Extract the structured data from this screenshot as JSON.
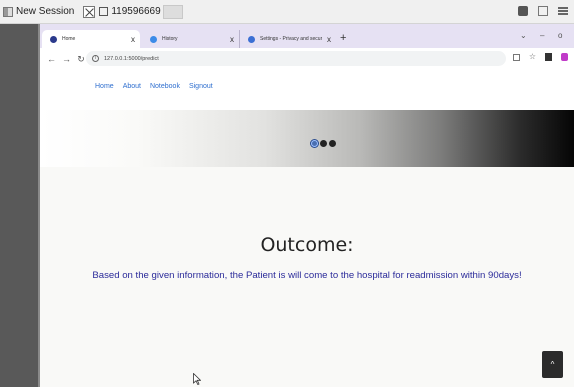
{
  "session": {
    "label": "New Session",
    "id": "119596669"
  },
  "browser": {
    "tabs": [
      {
        "title": "Home",
        "favicon_color": "#2b3a8c"
      },
      {
        "title": "History",
        "favicon_color": "#3c8be8"
      },
      {
        "title": "Settings - Privacy and security",
        "favicon_color": "#3b6fd4"
      }
    ],
    "new_tab": "+",
    "close": "x",
    "url": "127.0.0.1:5000/predict",
    "minimize": "–",
    "maximize": "o"
  },
  "nav": {
    "links": [
      "Home",
      "About",
      "Notebook",
      "Signout"
    ]
  },
  "main": {
    "heading": "Outcome:",
    "result_text": "Based on the given information, the Patient is will come to the hospital for readmission within 90days!"
  },
  "scroll_top_icon": "^",
  "icons": {
    "tab_close": "close-icon",
    "scroll": "chevron-up-icon"
  },
  "colors": {
    "result_text": "#2b2b9a",
    "nav_link": "#2f6fcf",
    "tab_strip": "#e6e1f3"
  }
}
